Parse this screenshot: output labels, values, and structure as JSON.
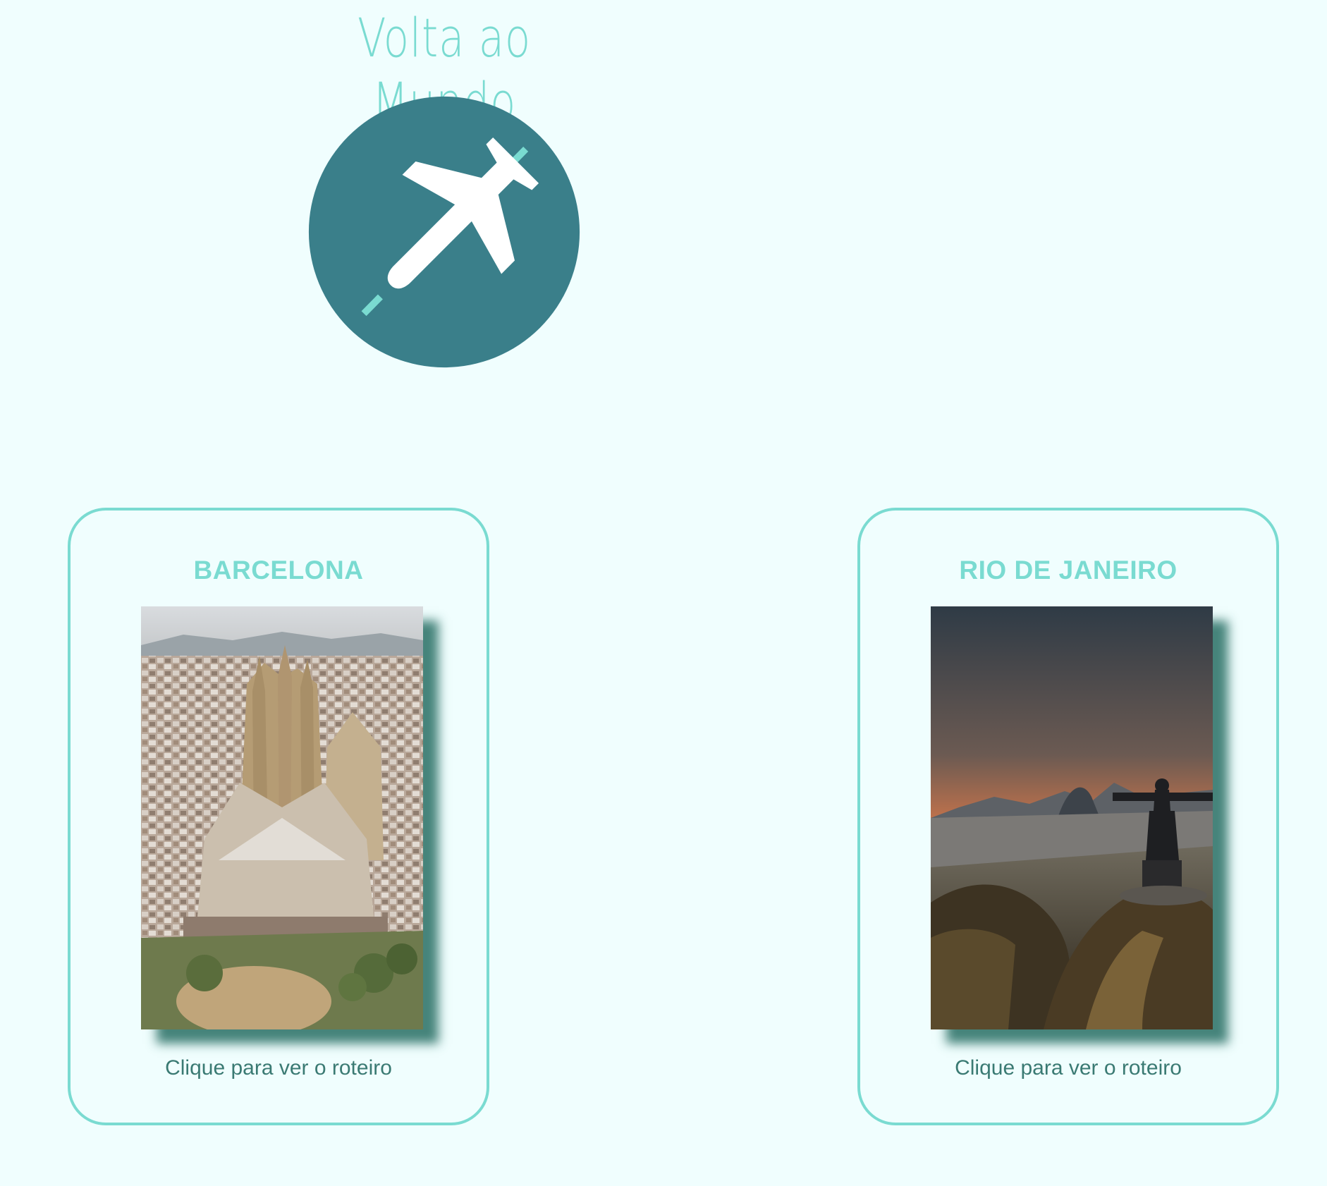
{
  "header": {
    "title": "Volta ao Mundo",
    "logo_icon": "airplane-icon"
  },
  "colors": {
    "background": "#f0fefe",
    "accent": "#7adbd1",
    "logo_circle": "#3a7f8a",
    "caption": "#3a7a73"
  },
  "destinations": [
    {
      "name": "BARCELONA",
      "photo": "sagrada-familia-aerial-photo",
      "caption": "Clique para ver o roteiro"
    },
    {
      "name": "RIO DE JANEIRO",
      "photo": "cristo-redentor-sunset-photo",
      "caption": "Clique para ver o roteiro"
    }
  ]
}
